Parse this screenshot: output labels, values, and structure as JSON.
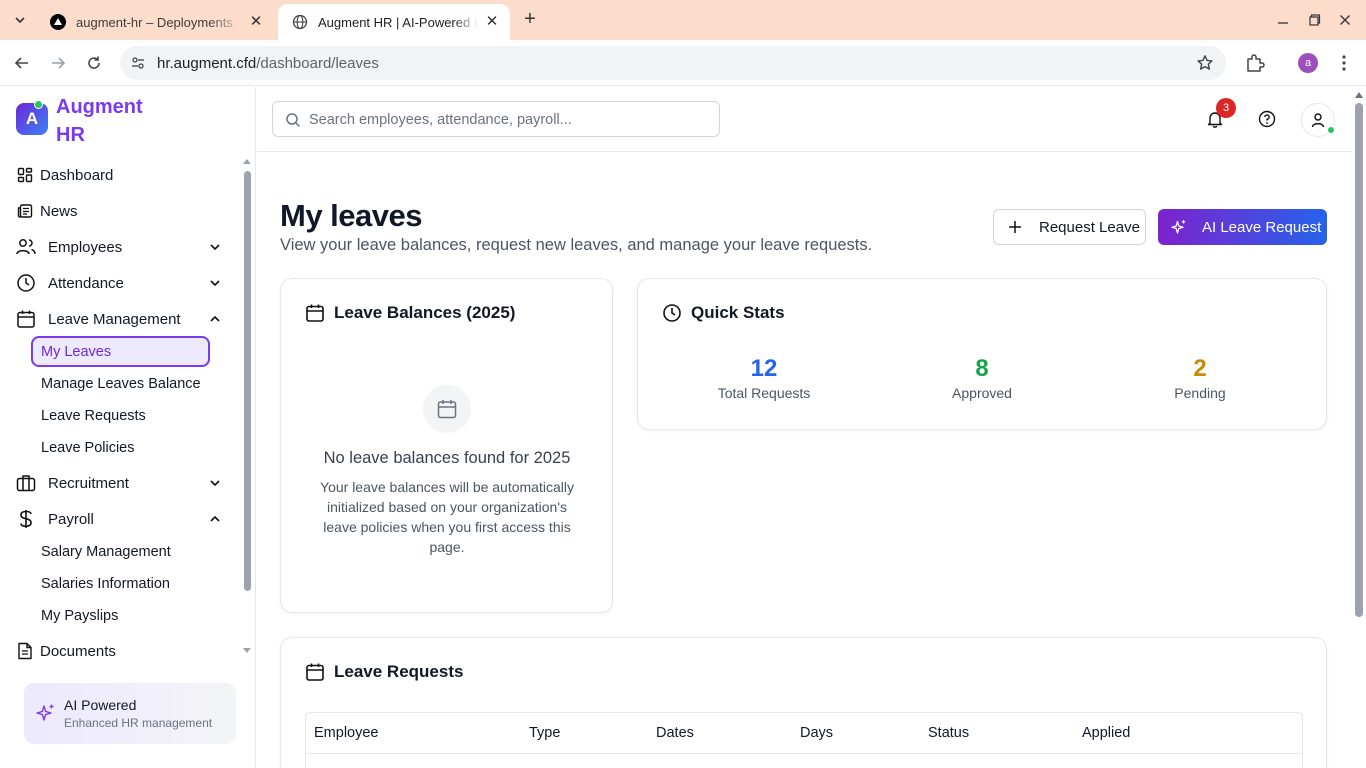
{
  "browser": {
    "tabs": [
      {
        "title": "augment-hr – Deployments"
      },
      {
        "title": "Augment HR | AI-Powered HR"
      }
    ],
    "url_host": "hr.augment.cfd",
    "url_path": "/dashboard/leaves",
    "profile_initial": "a"
  },
  "app": {
    "logo_letter": "A",
    "brand": "Augment HR"
  },
  "sidebar": {
    "items": [
      {
        "label": "Dashboard"
      },
      {
        "label": "News"
      },
      {
        "label": "Employees"
      },
      {
        "label": "Attendance"
      },
      {
        "label": "Leave Management"
      },
      {
        "label": "Recruitment"
      },
      {
        "label": "Payroll"
      },
      {
        "label": "Documents"
      }
    ],
    "leave_sub": [
      "My Leaves",
      "Manage Leaves Balance",
      "Leave Requests",
      "Leave Policies"
    ],
    "payroll_sub": [
      "Salary Management",
      "Salaries Information",
      "My Payslips"
    ],
    "ai_card": {
      "title": "AI Powered",
      "subtitle": "Enhanced HR management"
    }
  },
  "topbar": {
    "search_placeholder": "Search employees, attendance, payroll...",
    "notification_count": "3"
  },
  "page": {
    "title": "My leaves",
    "subtitle": "View your leave balances, request new leaves, and manage your leave requests.",
    "request_leave_label": "Request Leave",
    "ai_leave_label": "AI Leave Request"
  },
  "balances": {
    "title": "Leave Balances (2025)",
    "empty_title": "No leave balances found for 2025",
    "empty_text": "Your leave balances will be automatically initialized based on your organization's leave policies when you first access this page."
  },
  "quick_stats": {
    "title": "Quick Stats",
    "stats": [
      {
        "value": "12",
        "label": "Total Requests",
        "color": "#2563eb"
      },
      {
        "value": "8",
        "label": "Approved",
        "color": "#16a34a"
      },
      {
        "value": "2",
        "label": "Pending",
        "color": "#ca8a04"
      }
    ]
  },
  "leave_requests": {
    "title": "Leave Requests",
    "columns": [
      "Employee",
      "Type",
      "Dates",
      "Days",
      "Status",
      "Applied"
    ]
  },
  "colors": {
    "accent": "#7c3aed",
    "accent_blue": "#2563eb",
    "chrome_tabbar": "#fcdccb"
  }
}
